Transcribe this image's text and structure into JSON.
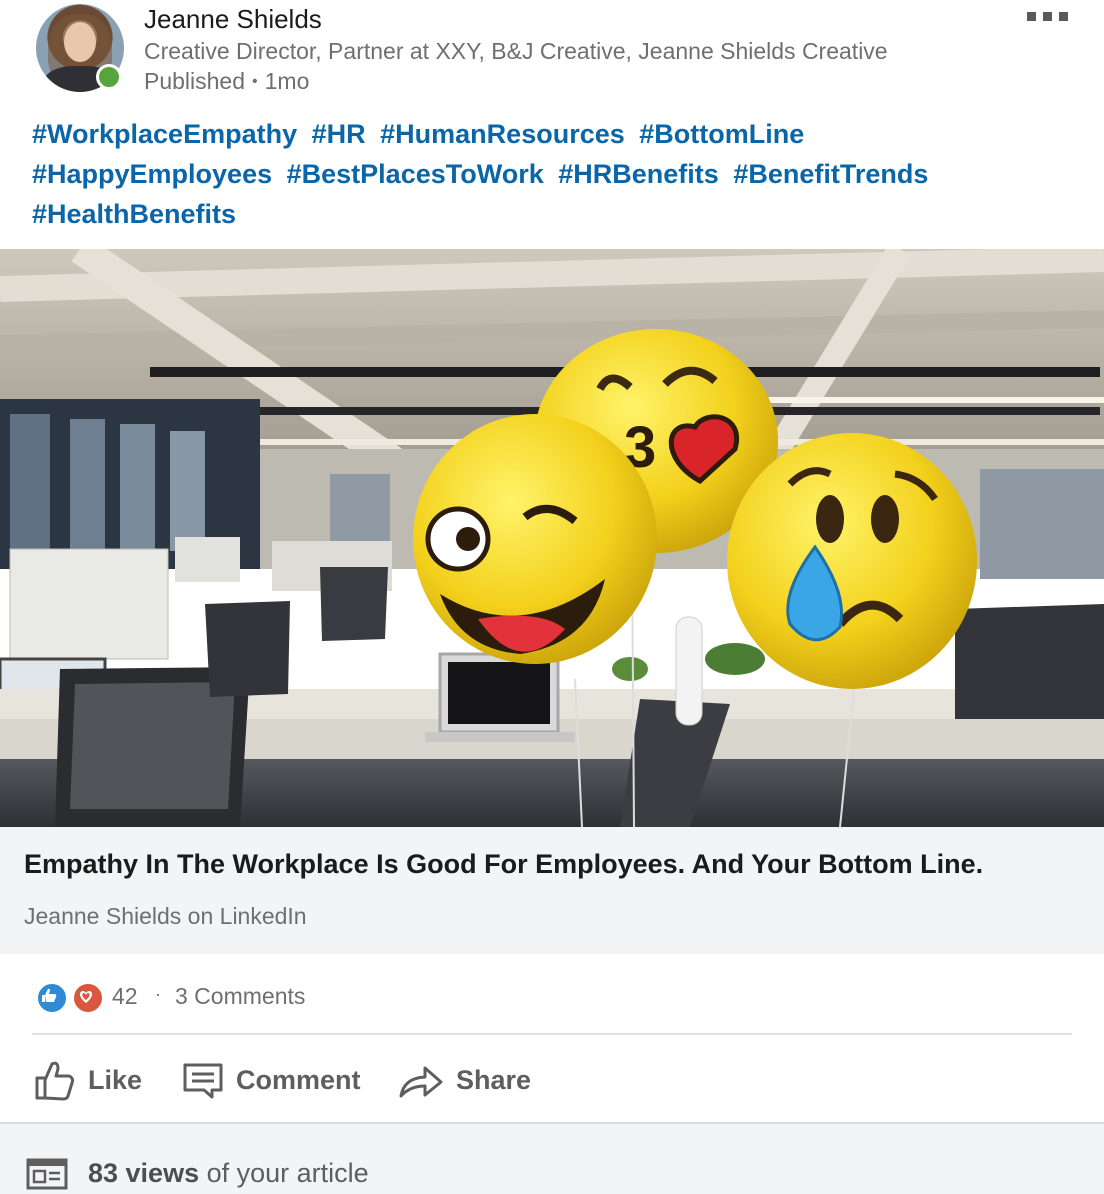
{
  "author": {
    "name": "Jeanne Shields",
    "headline": "Creative Director, Partner at XXY, B&J Creative, Jeanne Shields Creative",
    "status": "Published",
    "time": "1mo"
  },
  "hashtags": [
    "#WorkplaceEmpathy",
    "#HR",
    "#HumanResources",
    "#BottomLine",
    "#HappyEmployees",
    "#BestPlacesToWork",
    "#HRBenefits",
    "#BenefitTrends",
    "#HealthBenefits"
  ],
  "article": {
    "title": "Empathy In The Workplace Is Good For Employees. And Your Bottom Line.",
    "source": "Jeanne Shields on LinkedIn"
  },
  "social": {
    "reactions_count": "42",
    "comments": "3 Comments",
    "reaction_icons": [
      "like-icon",
      "love-icon"
    ]
  },
  "actions": {
    "like": "Like",
    "comment": "Comment",
    "share": "Share"
  },
  "footer": {
    "views_count": "83 views",
    "views_suffix": "of your article"
  },
  "colors": {
    "hashtag": "#0a66a8",
    "presence": "#56a43a",
    "card_bg": "#f2f4f6"
  }
}
